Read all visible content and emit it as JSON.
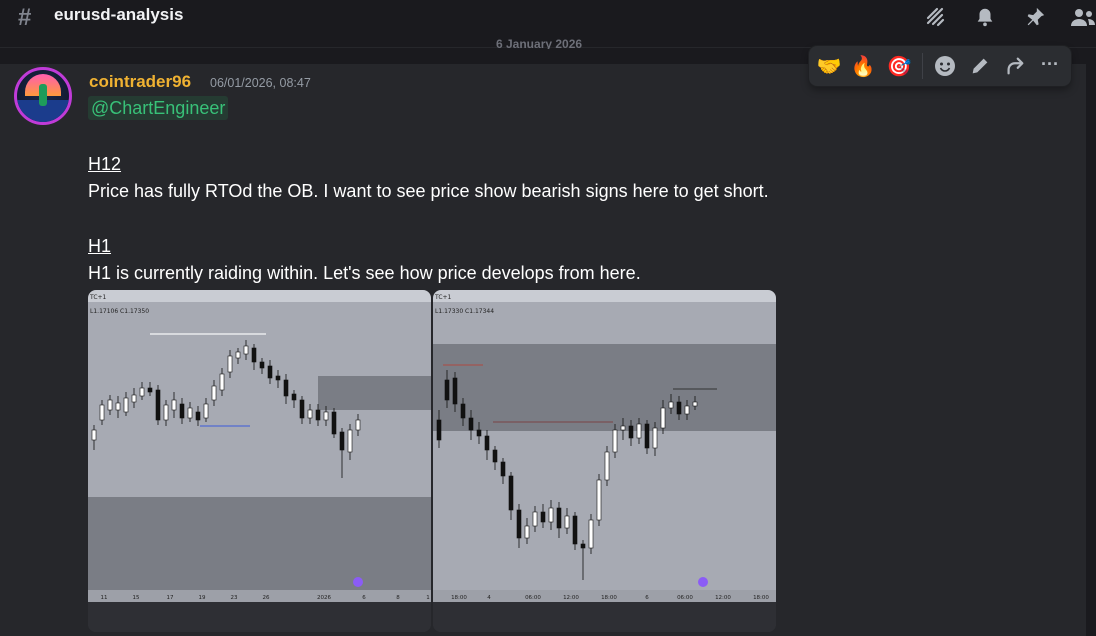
{
  "channel": {
    "name": "eurusd-analysis",
    "hash_icon": "#"
  },
  "header_icons": [
    "threads-icon",
    "bell-icon",
    "pin-icon",
    "members-icon"
  ],
  "divider": {
    "date": "6 January 2026"
  },
  "message": {
    "author": "cointrader96",
    "author_color": "#f0b232",
    "timestamp": "06/01/2026, 08:47",
    "mention": "@ChartEngineer",
    "sections": [
      {
        "heading": "H12",
        "text": "Price has fully RTOd the OB. I want to see price show bearish signs here to get short."
      },
      {
        "heading": "H1",
        "text": "H1 is currently raiding within. Let's see how price develops from here."
      }
    ]
  },
  "toolbar": {
    "reactions": [
      "🤝",
      "🔥",
      "🎯"
    ],
    "actions": [
      "add-reaction-icon",
      "edit-icon",
      "forward-icon",
      "more-icon"
    ],
    "more_glyph": "···"
  },
  "attachments": [
    {
      "name": "H12 chart",
      "timezone": "TC+1",
      "ohlc": "L1.17106  C1.17350",
      "x_ticks": [
        "11",
        "15",
        "17",
        "19",
        "23",
        "26",
        "2026",
        "6",
        "8",
        "1"
      ]
    },
    {
      "name": "H1 chart",
      "timezone": "TC+1",
      "ohlc": "L1.17330  C1.17344",
      "x_ticks": [
        "18:00",
        "4",
        "06:00",
        "12:00",
        "18:00",
        "6",
        "06:00",
        "12:00",
        "18:00"
      ]
    }
  ],
  "chart_bg": "#a7aab3",
  "zone_color": "#7a7d85"
}
